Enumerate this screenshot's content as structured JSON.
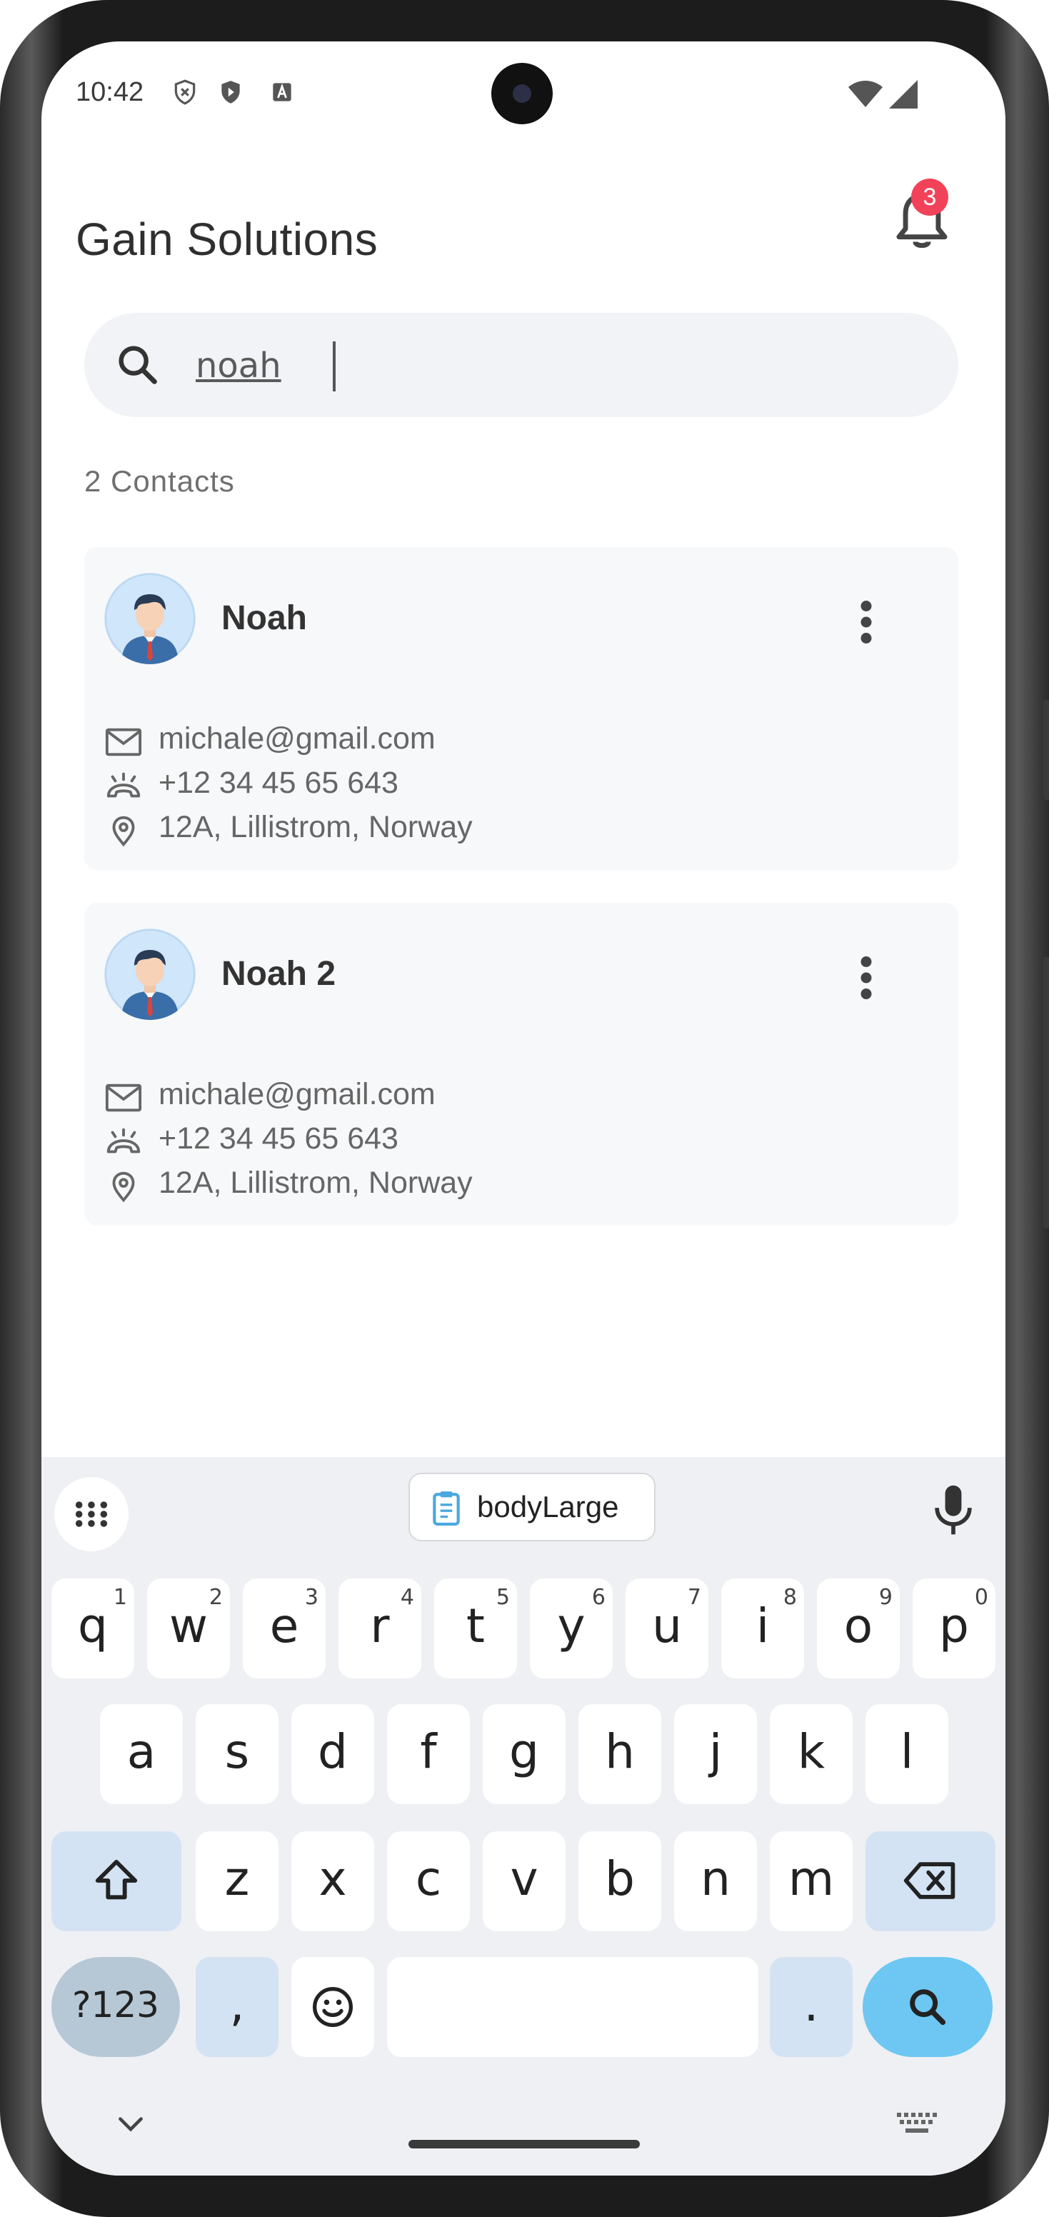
{
  "status_bar": {
    "time": "10:42"
  },
  "header": {
    "title": "Gain Solutions",
    "notification_count": "3"
  },
  "search": {
    "value": "noah",
    "placeholder": ""
  },
  "results": {
    "count_label": "2 Contacts"
  },
  "contacts": [
    {
      "name": "Noah",
      "email": "michale@gmail.com",
      "phone": "+12 34 45 65 643",
      "address": "12A, Lillistrom, Norway"
    },
    {
      "name": "Noah 2",
      "email": "michale@gmail.com",
      "phone": "+12 34 45 65 643",
      "address": "12A, Lillistrom, Norway"
    }
  ],
  "keyboard": {
    "suggestion_chip": "bodyLarge",
    "row1": [
      {
        "key": "q",
        "hint": "1"
      },
      {
        "key": "w",
        "hint": "2"
      },
      {
        "key": "e",
        "hint": "3"
      },
      {
        "key": "r",
        "hint": "4"
      },
      {
        "key": "t",
        "hint": "5"
      },
      {
        "key": "y",
        "hint": "6"
      },
      {
        "key": "u",
        "hint": "7"
      },
      {
        "key": "i",
        "hint": "8"
      },
      {
        "key": "o",
        "hint": "9"
      },
      {
        "key": "p",
        "hint": "0"
      }
    ],
    "row2": [
      "a",
      "s",
      "d",
      "f",
      "g",
      "h",
      "j",
      "k",
      "l"
    ],
    "row3": [
      "z",
      "x",
      "c",
      "v",
      "b",
      "n",
      "m"
    ],
    "symbols_label": "?123",
    "comma_label": ",",
    "period_label": "."
  },
  "colors": {
    "badge": "#f2425a",
    "enter_key": "#6dc7f2",
    "modifier_key": "#d3e3f4"
  }
}
